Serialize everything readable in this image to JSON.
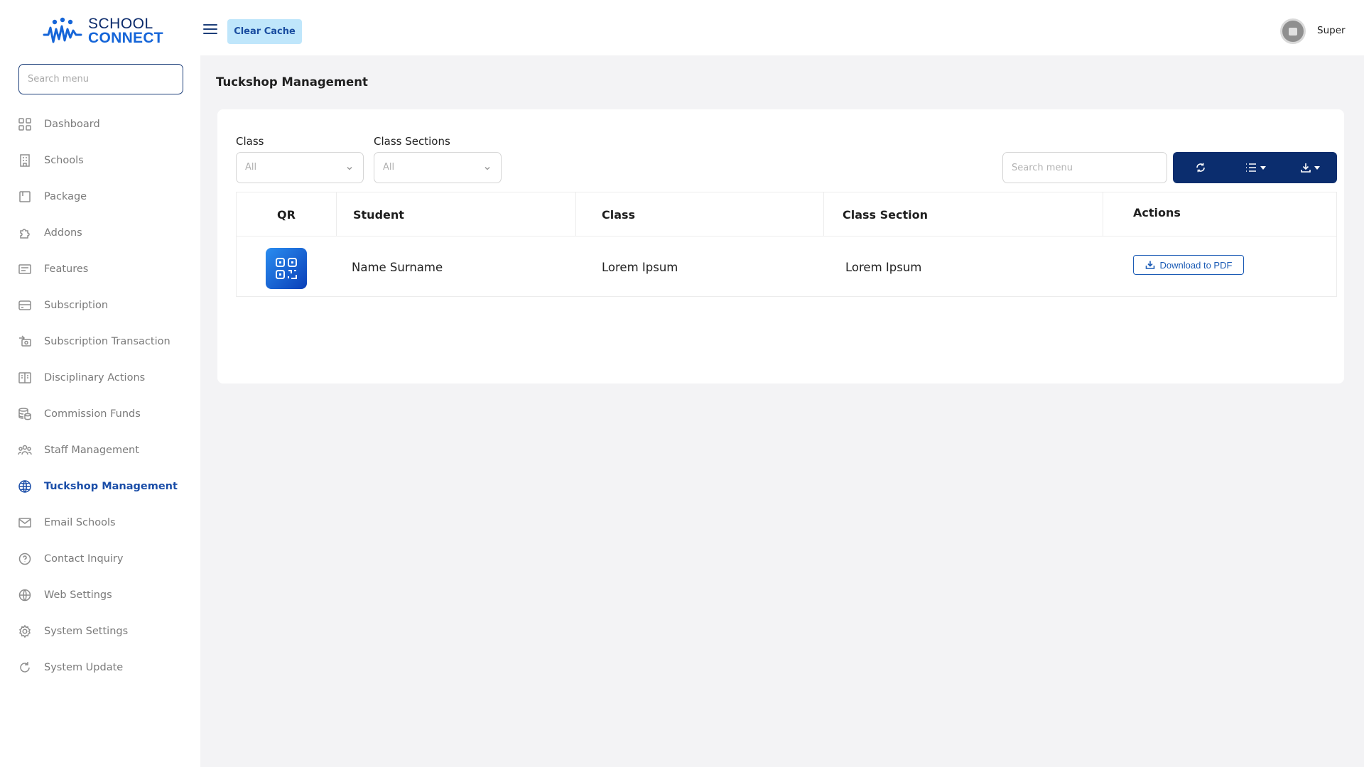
{
  "brand": {
    "line1": "SCHOOL",
    "line2": "CONNECT",
    "colors": {
      "dark": "#0b2a6b",
      "accent": "#1565d8"
    }
  },
  "sidebar": {
    "search_placeholder": "Search menu",
    "items": [
      {
        "label": "Dashboard",
        "icon": "grid-icon"
      },
      {
        "label": "Schools",
        "icon": "building-icon"
      },
      {
        "label": "Package",
        "icon": "box-icon"
      },
      {
        "label": "Addons",
        "icon": "puzzle-icon"
      },
      {
        "label": "Features",
        "icon": "list-card-icon"
      },
      {
        "label": "Subscription",
        "icon": "credit-card-icon"
      },
      {
        "label": "Subscription Transaction",
        "icon": "cash-transfer-icon"
      },
      {
        "label": "Disciplinary Actions",
        "icon": "report-icon"
      },
      {
        "label": "Commission Funds",
        "icon": "coins-icon"
      },
      {
        "label": "Staff Management",
        "icon": "people-icon"
      },
      {
        "label": "Tuckshop Management",
        "icon": "globe-active-icon",
        "active": true
      },
      {
        "label": "Email Schools",
        "icon": "mail-icon"
      },
      {
        "label": "Contact Inquiry",
        "icon": "help-circle-icon"
      },
      {
        "label": "Web Settings",
        "icon": "globe-icon"
      },
      {
        "label": "System Settings",
        "icon": "gear-icon"
      },
      {
        "label": "System Update",
        "icon": "refresh-icon"
      }
    ],
    "active_color": "#1b4ea8"
  },
  "header": {
    "clear_cache_label": "Clear Cache",
    "user_name": "Super"
  },
  "main": {
    "page_title": "Tuckshop Management",
    "filters": {
      "class_label": "Class",
      "class_value": "All",
      "section_label": "Class Sections",
      "section_value": "All"
    },
    "table_search_placeholder": "Search menu",
    "toolbar": {
      "buttons": [
        "refresh-icon",
        "columns-icon",
        "export-icon"
      ],
      "color": "#0b2d6e"
    },
    "table": {
      "columns": [
        "QR",
        "Student",
        "Class",
        "Class Section",
        "Actions"
      ],
      "rows": [
        {
          "qr_icon": "qr-code-icon",
          "student": "Name Surname",
          "class": "Lorem Ipsum",
          "section": "Lorem Ipsum",
          "action_label": "Download to PDF"
        }
      ]
    }
  }
}
